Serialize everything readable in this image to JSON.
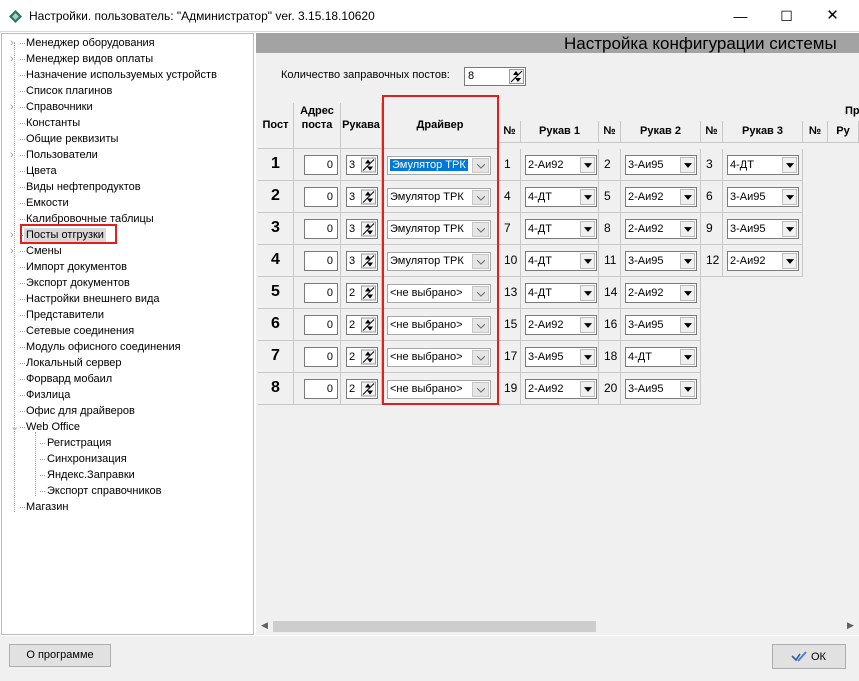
{
  "window": {
    "title": "Настройки. пользователь: \"Администратор\" ver. 3.15.18.10620",
    "minimize": "—",
    "maximize": "☐",
    "close": "✕"
  },
  "tree": {
    "items": [
      {
        "label": "Менеджер оборудования",
        "arrow": "›"
      },
      {
        "label": "Менеджер видов оплаты",
        "arrow": "›"
      },
      {
        "label": "Назначение используемых устройств",
        "arrow": ""
      },
      {
        "label": "Список плагинов",
        "arrow": ""
      },
      {
        "label": "Справочники",
        "arrow": "›"
      },
      {
        "label": "Константы",
        "arrow": ""
      },
      {
        "label": "Общие реквизиты",
        "arrow": ""
      },
      {
        "label": "Пользователи",
        "arrow": "›"
      },
      {
        "label": "Цвета",
        "arrow": ""
      },
      {
        "label": "Виды нефтепродуктов",
        "arrow": ""
      },
      {
        "label": "Емкости",
        "arrow": ""
      },
      {
        "label": "Калибровочные таблицы",
        "arrow": ""
      },
      {
        "label": "Посты отгрузки",
        "arrow": "›",
        "selected": true
      },
      {
        "label": "Смены",
        "arrow": "›"
      },
      {
        "label": "Импорт документов",
        "arrow": ""
      },
      {
        "label": "Экспорт документов",
        "arrow": ""
      },
      {
        "label": "Настройки внешнего вида",
        "arrow": ""
      },
      {
        "label": "Представители",
        "arrow": ""
      },
      {
        "label": "Сетевые соединения",
        "arrow": ""
      },
      {
        "label": "Модуль офисного соединения",
        "arrow": ""
      },
      {
        "label": "Локальный сервер",
        "arrow": ""
      },
      {
        "label": "Форвард мобаил",
        "arrow": ""
      },
      {
        "label": "Физлица",
        "arrow": ""
      },
      {
        "label": "Офис для драйверов",
        "arrow": ""
      },
      {
        "label": "Web Office",
        "arrow": "⌄"
      },
      {
        "label": "Регистрация",
        "arrow": "",
        "child": true
      },
      {
        "label": "Синхронизация",
        "arrow": "",
        "child": true
      },
      {
        "label": "Яндекс.Заправки",
        "arrow": "",
        "child": true
      },
      {
        "label": "Экспорт справочников",
        "arrow": "",
        "child": true
      },
      {
        "label": "Магазин",
        "arrow": ""
      }
    ]
  },
  "panel": {
    "title": "Настройка конфигурации системы",
    "posts_count_label": "Количество заправочных постов:",
    "posts_count": "8"
  },
  "table": {
    "headers": {
      "post": "Пост",
      "address_l1": "Адрес",
      "address_l2": "поста",
      "hoses": "Рукава",
      "driver": "Драйвер",
      "num": "№",
      "hose1": "Рукав 1",
      "hose2": "Рукав 2",
      "hose3": "Рукав 3",
      "extra_top": "Пр",
      "extra": "Ру"
    },
    "rows": [
      {
        "post": "1",
        "addr": "0",
        "hoses": "3",
        "driver": "Эмулятор ТРК",
        "driver_selected": true,
        "h": [
          {
            "n": "1",
            "v": "2-Аи92"
          },
          {
            "n": "2",
            "v": "3-Аи95"
          },
          {
            "n": "3",
            "v": "4-ДТ"
          }
        ]
      },
      {
        "post": "2",
        "addr": "0",
        "hoses": "3",
        "driver": "Эмулятор ТРК",
        "driver_selected": false,
        "h": [
          {
            "n": "4",
            "v": "4-ДТ"
          },
          {
            "n": "5",
            "v": "2-Аи92"
          },
          {
            "n": "6",
            "v": "3-Аи95"
          }
        ]
      },
      {
        "post": "3",
        "addr": "0",
        "hoses": "3",
        "driver": "Эмулятор ТРК",
        "driver_selected": false,
        "h": [
          {
            "n": "7",
            "v": "4-ДТ"
          },
          {
            "n": "8",
            "v": "2-Аи92"
          },
          {
            "n": "9",
            "v": "3-Аи95"
          }
        ]
      },
      {
        "post": "4",
        "addr": "0",
        "hoses": "3",
        "driver": "Эмулятор ТРК",
        "driver_selected": false,
        "h": [
          {
            "n": "10",
            "v": "4-ДТ"
          },
          {
            "n": "11",
            "v": "3-Аи95"
          },
          {
            "n": "12",
            "v": "2-Аи92"
          }
        ]
      },
      {
        "post": "5",
        "addr": "0",
        "hoses": "2",
        "driver": "<не выбрано>",
        "driver_selected": false,
        "h": [
          {
            "n": "13",
            "v": "4-ДТ"
          },
          {
            "n": "14",
            "v": "2-Аи92"
          }
        ]
      },
      {
        "post": "6",
        "addr": "0",
        "hoses": "2",
        "driver": "<не выбрано>",
        "driver_selected": false,
        "h": [
          {
            "n": "15",
            "v": "2-Аи92"
          },
          {
            "n": "16",
            "v": "3-Аи95"
          }
        ]
      },
      {
        "post": "7",
        "addr": "0",
        "hoses": "2",
        "driver": "<не выбрано>",
        "driver_selected": false,
        "h": [
          {
            "n": "17",
            "v": "3-Аи95"
          },
          {
            "n": "18",
            "v": "4-ДТ"
          }
        ]
      },
      {
        "post": "8",
        "addr": "0",
        "hoses": "2",
        "driver": "<не выбрано>",
        "driver_selected": false,
        "h": [
          {
            "n": "19",
            "v": "2-Аи92"
          },
          {
            "n": "20",
            "v": "3-Аи95"
          }
        ]
      }
    ]
  },
  "buttons": {
    "about": "О программе",
    "ok": "ОК"
  },
  "colors": {
    "highlight_box": "#e02020",
    "selection": "#0078d7"
  }
}
